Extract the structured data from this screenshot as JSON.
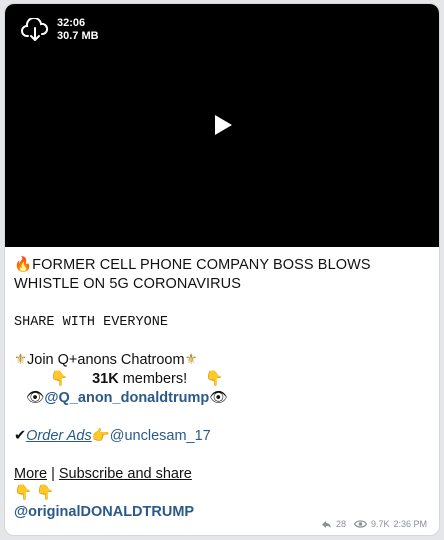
{
  "video": {
    "duration": "32:06",
    "size": "30.7 MB"
  },
  "message": {
    "headline_emoji": "🔥",
    "headline": "FORMER CELL PHONE COMPANY BOSS BLOWS WHISTLE ON 5G CORONAVIRUS",
    "share_line": "SHARE WITH EVERYONE",
    "fleur_left": "⚜",
    "join_text": "Join Q+anons Chatroom",
    "fleur_right": "⚜",
    "point_down": "👇",
    "members_count": "31K",
    "members_label": " members!",
    "eyes": "👁",
    "chat_handle": "@Q_anon_donaldtrump",
    "check": "✔",
    "order_ads": "Order Ads",
    "point_right": "👉",
    "ads_handle": "@unclesam_17",
    "more": "More",
    "separator": " | ",
    "subscribe": "Subscribe and share",
    "footer_handle": "@originalDONALDTRUMP"
  },
  "footer": {
    "forwards": "28",
    "views": "9.7K",
    "time": "2:36 PM"
  }
}
